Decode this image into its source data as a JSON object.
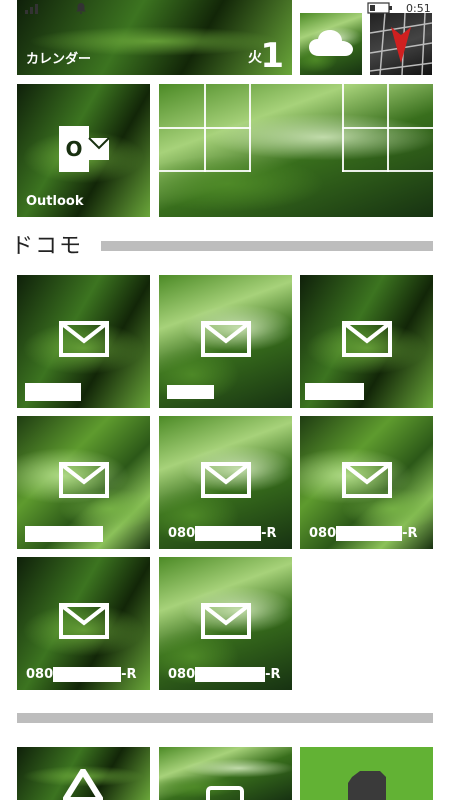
{
  "status_bar": {
    "time": "0:51"
  },
  "tiles": {
    "calendar": {
      "label": "カレンダー",
      "weekday": "火",
      "day": "1"
    },
    "outlook": {
      "label": "Outlook"
    }
  },
  "section": {
    "title": "ドコモ"
  },
  "mail_tiles": [
    {
      "label": ""
    },
    {
      "label": ""
    },
    {
      "label": ""
    },
    {
      "label": ""
    },
    {
      "label_prefix": "080",
      "label_suffix": "-R"
    },
    {
      "label_prefix": "080",
      "label_suffix": "-R"
    },
    {
      "label_prefix": "080",
      "label_suffix": "-R"
    },
    {
      "label_prefix": "080",
      "label_suffix": "-R"
    }
  ],
  "colors": {
    "accent_green": "#62b234",
    "tile_text": "#ffffff",
    "divider": "#bdbdbd"
  }
}
